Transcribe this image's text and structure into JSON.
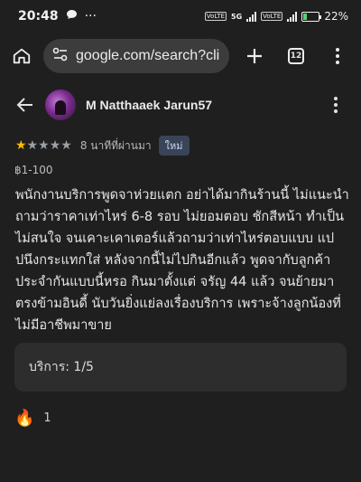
{
  "status_bar": {
    "time": "20:48",
    "dots": "···",
    "network": "5G",
    "battery": "22%"
  },
  "browser": {
    "url": "google.com/search?client",
    "tab_count": "12"
  },
  "review": {
    "reviewer_name": "M Natthaaek Jarun57",
    "rating": 1,
    "max_rating": 5,
    "time_ago": "8 นาทีที่ผ่านมา",
    "new_badge": "ใหม่",
    "price_range": "฿1-100",
    "text": "พนักงานบริการพูดจาห่วยแตก อย่าได้มากินร้านนี้ ไม่แนะนำ ถามว่าราคาเท่าไหร่ 6-8 รอบ ไม่ยอมตอบ ชักสีหน้า ทำเป็นไม่สนใจ จนเคาะเคาเตอร์แล้วถามว่าเท่าไหร่ตอบแบบ แปปนึงกระแทกใส่ หลังจากนี้ไม่ไปกินอีกแล้ว พูดจากับลูกค้าประจำกันแบบนี้หรอ กินมาตั้งแต่ จรัญ 44 แล้ว จนย้ายมาตรงข้ามอินดี้ นับวันยิ่งแย่ลงเรื่องบริการ เพราะจ้างลูกน้องที่ไม่มีอาชีพมาขาย",
    "service_rating": "บริการ: 1/5",
    "reaction_emoji": "🔥",
    "reaction_count": "1"
  },
  "colors": {
    "background": "#1f1f1f",
    "star_active": "#fbbc04",
    "star_inactive": "#9aa0a6",
    "badge_bg": "#3a4458"
  }
}
